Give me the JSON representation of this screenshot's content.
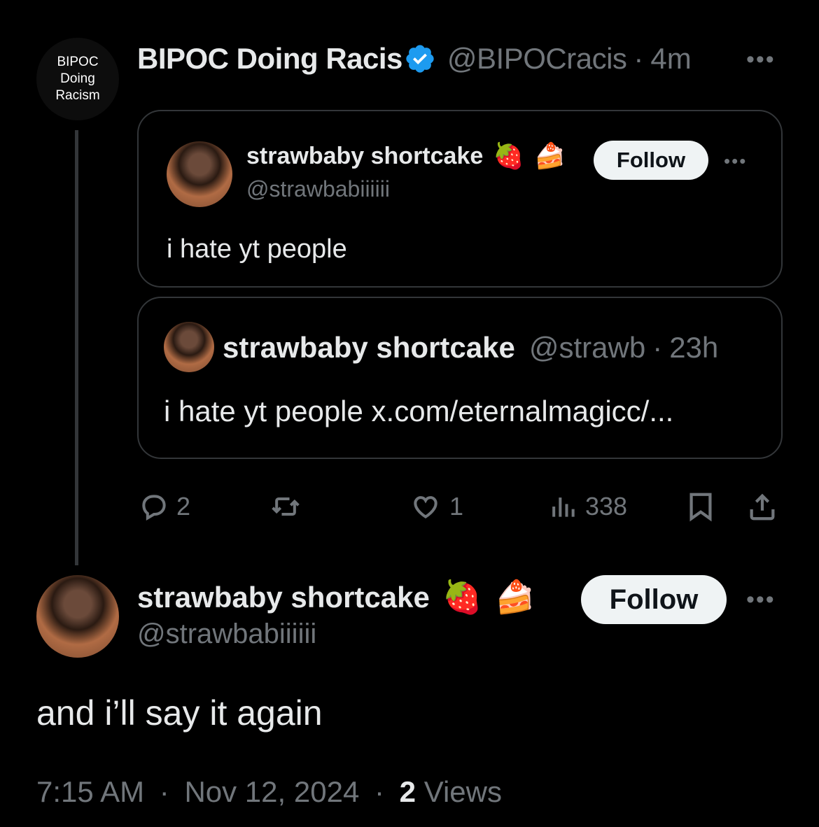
{
  "parent_tweet": {
    "avatar_text": [
      "BIPOC",
      "Doing",
      "Racism"
    ],
    "display_name": "BIPOC Doing Racis",
    "handle": "@BIPOCracis",
    "time": "4m",
    "verified": true,
    "more_label": "•••"
  },
  "quote_card_1": {
    "display_name": "strawbaby shortcake",
    "emojis": [
      "🍓",
      "🍰"
    ],
    "handle": "@strawbabiiiiii",
    "follow_label": "Follow",
    "more_label": "•••",
    "text": "i hate yt people"
  },
  "quote_card_2": {
    "display_name": "strawbaby shortcake",
    "handle": "@strawb",
    "time": "23h",
    "text": "i hate yt people x.com/eternalmagicc/..."
  },
  "actions": {
    "replies": "2",
    "retweets": "",
    "likes": "1",
    "views": "338"
  },
  "main_tweet": {
    "display_name": "strawbaby shortcake",
    "emojis": [
      "🍓",
      "🍰"
    ],
    "handle": "@strawbabiiiiii",
    "follow_label": "Follow",
    "more_label": "•••",
    "text": "and i’ll say it again",
    "time": "7:15 AM",
    "date": "Nov 12, 2024",
    "views_count": "2",
    "views_label": "Views"
  },
  "colors": {
    "background": "#000000",
    "text": "#e7e9ea",
    "muted": "#71767b",
    "border": "#333639",
    "verified": "#1d9bf0",
    "button_bg": "#eff3f4"
  },
  "separator": "·"
}
